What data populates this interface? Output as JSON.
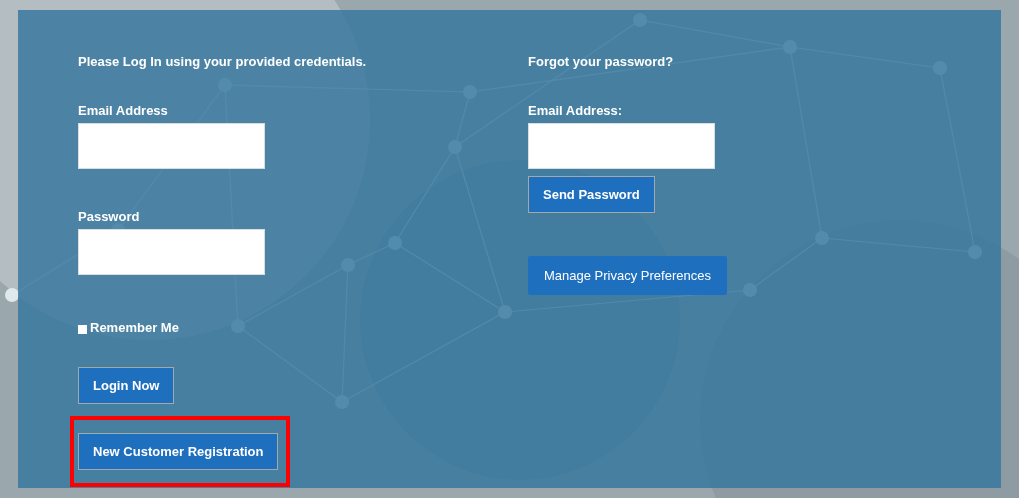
{
  "login": {
    "intro": "Please Log In using your provided credentials.",
    "fields": [
      {
        "label": "Email Address"
      },
      {
        "label": "Password"
      }
    ],
    "remember": {
      "label": "Remember Me",
      "checked": false
    },
    "buttons": [
      {
        "label": "Login Now",
        "highlighted": false
      },
      {
        "label": "New Customer Registration",
        "highlighted": true
      }
    ]
  },
  "forgot": {
    "heading": "Forgot your password?",
    "field": {
      "label": "Email Address:"
    },
    "send_button": "Send Password",
    "privacy_button": "Manage Privacy Preferences"
  }
}
